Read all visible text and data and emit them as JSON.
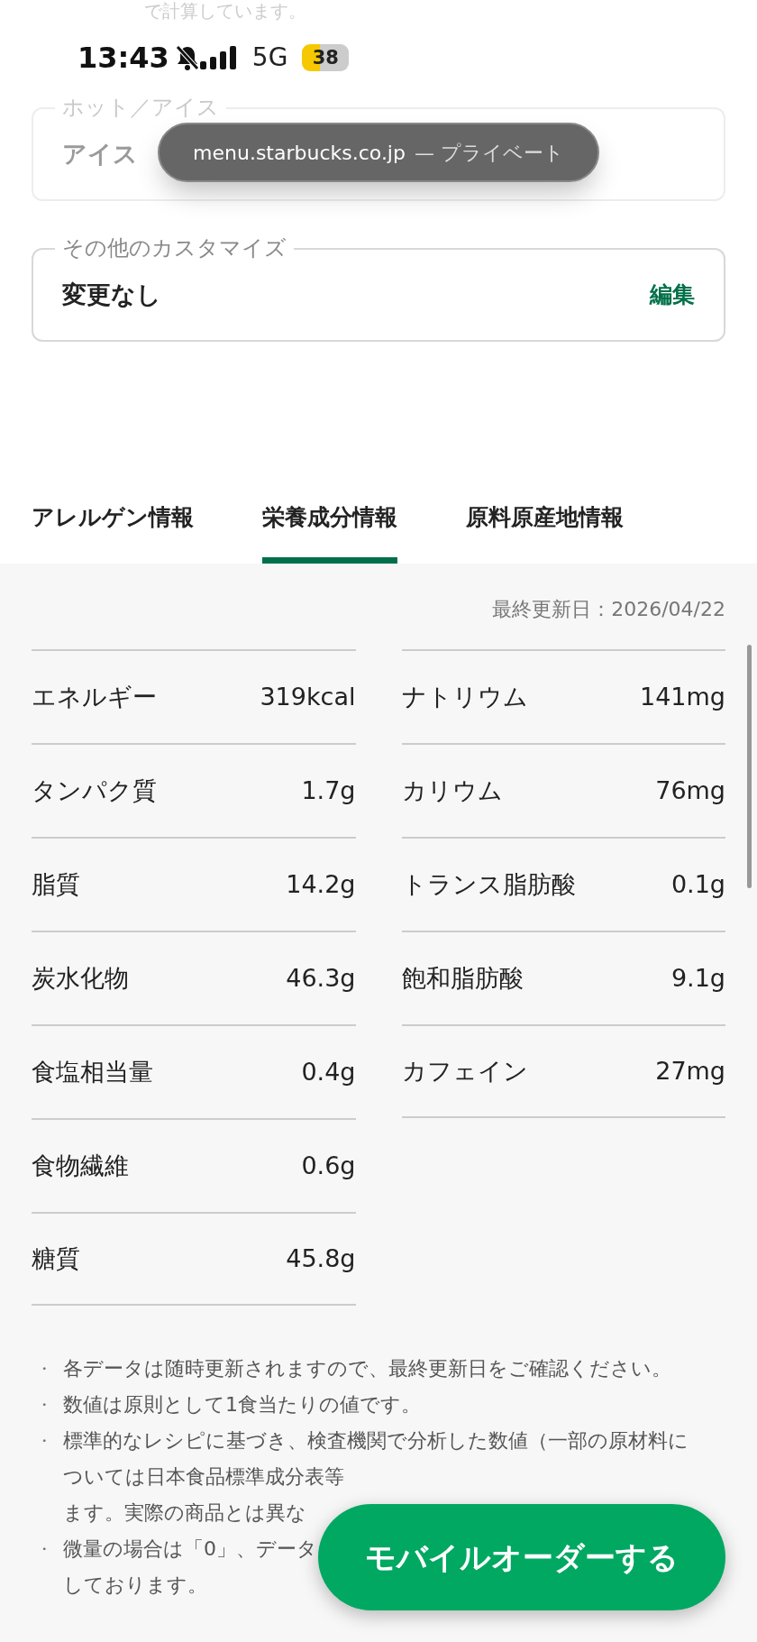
{
  "top_cut_text": "で計算しています。",
  "status_bar": {
    "time": "13:43",
    "silent": true,
    "network": "5G",
    "battery": "38"
  },
  "url_pill": {
    "domain": "menu.starbucks.co.jp",
    "mode": "— プライベート"
  },
  "fields": [
    {
      "legend": "ホット／アイス",
      "value": "アイス",
      "faded": true
    },
    {
      "legend": "その他のカスタマイズ",
      "value": "変更なし",
      "faded": false,
      "action": "編集"
    }
  ],
  "tabs": [
    {
      "label": "アレルゲン情報",
      "selected": false
    },
    {
      "label": "栄養成分情報",
      "selected": true
    },
    {
      "label": "原料原産地情報",
      "selected": false
    }
  ],
  "updated": "最終更新日：2026/04/22",
  "nutrition_left": [
    {
      "name": "エネルギー",
      "value": "319kcal"
    },
    {
      "name": "タンパク質",
      "value": "1.7g"
    },
    {
      "name": "脂質",
      "value": "14.2g"
    },
    {
      "name": "炭水化物",
      "value": "46.3g"
    },
    {
      "name": "食塩相当量",
      "value": "0.4g"
    },
    {
      "name": "食物繊維",
      "value": "0.6g"
    },
    {
      "name": "糖質",
      "value": "45.8g"
    }
  ],
  "nutrition_right": [
    {
      "name": "ナトリウム",
      "value": "141mg"
    },
    {
      "name": "カリウム",
      "value": "76mg"
    },
    {
      "name": "トランス脂肪酸",
      "value": "0.1g"
    },
    {
      "name": "飽和脂肪酸",
      "value": "9.1g"
    },
    {
      "name": "カフェイン",
      "value": "27mg"
    }
  ],
  "notes": [
    {
      "bullet": "・",
      "lines": [
        "各データは随時更新されますので、最終更新日をご確認ください。"
      ]
    },
    {
      "bullet": "・",
      "lines": [
        "数値は原則として1食当たりの値です。"
      ]
    },
    {
      "bullet": "・",
      "lines": [
        "標準的なレシピに基づき、検査機関で分析した数値（一部の原材料に",
        "ついては日本食品標準成分表等",
        "ます。実際の商品とは異な"
      ]
    },
    {
      "bullet": "・",
      "lines": [
        "微量の場合は「0」、データ",
        "しております。"
      ]
    }
  ],
  "order_button": "モバイルオーダーする"
}
